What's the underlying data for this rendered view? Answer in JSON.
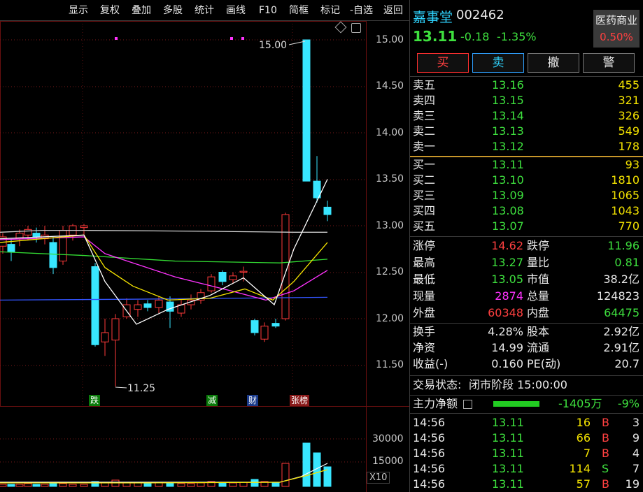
{
  "toolbar": [
    "显示",
    "复权",
    "叠加",
    "多股",
    "统计",
    "画线",
    "F10",
    "简框",
    "标记",
    "-自选",
    "返回"
  ],
  "chart": {
    "price_axis": [
      "15.00",
      "14.50",
      "14.00",
      "13.50",
      "13.00",
      "12.50",
      "12.00",
      "11.50"
    ],
    "volume_axis": [
      "30000",
      "15000"
    ],
    "volume_unit": "X10",
    "max_label": "15.00",
    "min_label": "11.25",
    "events": [
      "跌",
      "减",
      "财",
      "张榜"
    ],
    "colors": {
      "up": "#ff3a3a",
      "down": "#38e6ff",
      "ma5": "#ffffff",
      "ma10": "#f5e400",
      "ma20": "#ff33ff",
      "ma60": "#33dd33",
      "ma120": "#3355ff"
    }
  },
  "stock": {
    "name": "嘉事堂",
    "code": "002462",
    "price": "13.11",
    "change": "-0.18",
    "change_pct": "-1.35%",
    "sector": "医药商业",
    "sector_pct": "0.50%"
  },
  "actions": [
    "买",
    "卖",
    "撤",
    "警"
  ],
  "order_book": {
    "asks": [
      {
        "label": "卖五",
        "price": "13.16",
        "vol": "455"
      },
      {
        "label": "卖四",
        "price": "13.15",
        "vol": "321"
      },
      {
        "label": "卖三",
        "price": "13.14",
        "vol": "326"
      },
      {
        "label": "卖二",
        "price": "13.13",
        "vol": "549"
      },
      {
        "label": "卖一",
        "price": "13.12",
        "vol": "178"
      }
    ],
    "bids": [
      {
        "label": "买一",
        "price": "13.11",
        "vol": "93"
      },
      {
        "label": "买二",
        "price": "13.10",
        "vol": "1810"
      },
      {
        "label": "买三",
        "price": "13.09",
        "vol": "1065"
      },
      {
        "label": "买四",
        "price": "13.08",
        "vol": "1043"
      },
      {
        "label": "买五",
        "price": "13.07",
        "vol": "770"
      }
    ]
  },
  "stats1": [
    {
      "l1": "涨停",
      "v1": "14.62",
      "l2": "跌停",
      "v2": "11.96"
    },
    {
      "l1": "最高",
      "v1": "13.27",
      "l2": "量比",
      "v2": "0.81"
    },
    {
      "l1": "最低",
      "v1": "13.05",
      "l2": "市值",
      "v2": "38.2亿"
    },
    {
      "l1": "现量",
      "v1": "2874",
      "l2": "总量",
      "v2": "124823"
    },
    {
      "l1": "外盘",
      "v1": "60348",
      "l2": "内盘",
      "v2": "64475"
    }
  ],
  "stats2": [
    {
      "l1": "换手",
      "v1": "4.28%",
      "l2": "股本",
      "v2": "2.92亿"
    },
    {
      "l1": "净资",
      "v1": "14.99",
      "l2": "流通",
      "v2": "2.91亿"
    },
    {
      "l1": "收益(-)",
      "v1": "0.160",
      "l2": "PE(动)",
      "v2": "20.7"
    }
  ],
  "trade_status": {
    "label": "交易状态:",
    "value": "闭市阶段 15:00:00"
  },
  "main_flow": {
    "label": "主力净额",
    "amount": "-1405万",
    "pct": "-9%"
  },
  "ticks": [
    {
      "time": "14:56",
      "price": "13.11",
      "vol": "16",
      "side": "B",
      "n": "3"
    },
    {
      "time": "14:56",
      "price": "13.11",
      "vol": "66",
      "side": "B",
      "n": "9"
    },
    {
      "time": "14:56",
      "price": "13.11",
      "vol": "7",
      "side": "B",
      "n": "4"
    },
    {
      "time": "14:56",
      "price": "13.11",
      "vol": "114",
      "side": "S",
      "n": "7"
    },
    {
      "time": "14:56",
      "price": "13.11",
      "vol": "57",
      "side": "B",
      "n": "19"
    }
  ]
}
